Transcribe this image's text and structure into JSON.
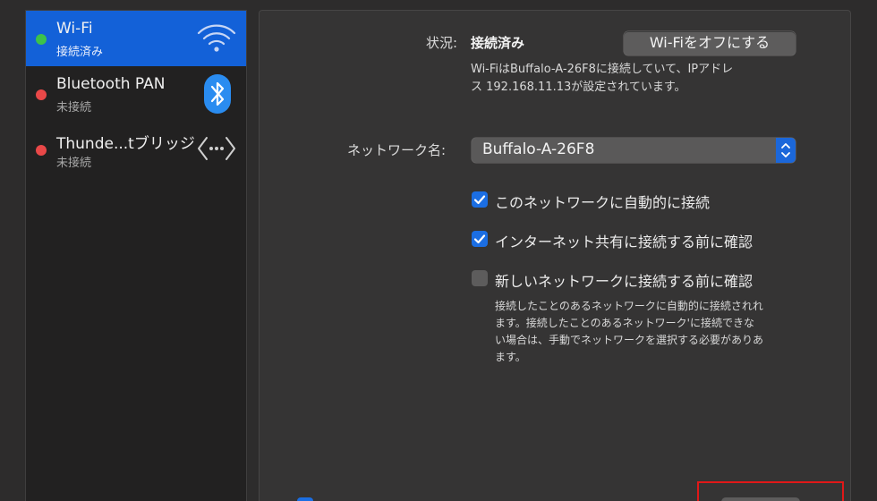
{
  "sidebar": {
    "services": [
      {
        "name": "Wi-Fi",
        "status": "接続済み",
        "dot_color": "#3cc24a",
        "icon": "wifi-icon",
        "selected": true
      },
      {
        "name": "Bluetooth PAN",
        "status": "未接続",
        "dot_color": "#e94848",
        "icon": "bluetooth-icon",
        "selected": false
      },
      {
        "name": "Thunde...tブリッジ",
        "status": "未接続",
        "dot_color": "#e94848",
        "icon": "thunderbolt-bridge-icon",
        "selected": false
      }
    ]
  },
  "detail": {
    "status_label": "状況:",
    "status_value": "接続済み",
    "toggle_button": "Wi-Fiをオフにする",
    "status_desc_line1": "Wi-FiはBuffalo-A-26F8に接続していて、IPアドレ",
    "status_desc_line2": "ス 192.168.11.13が設定されています。",
    "network_label": "ネットワーク名:",
    "network_value": "Buffalo-A-26F8",
    "options": [
      {
        "label": "このネットワークに自動的に接続",
        "checked": true
      },
      {
        "label": "インターネット共有に接続する前に確認",
        "checked": true
      },
      {
        "label": "新しいネットワークに接続する前に確認",
        "checked": false
      }
    ],
    "help_lines": [
      "接続したことのあるネットワークに自動的に接続されれ",
      "ます。接続したことのあるネットワーク'に接続できな",
      "い場合は、手動でネットワークを選択する必要がありあ",
      "ます。"
    ]
  },
  "colors": {
    "accent": "#1b6ee3",
    "selection": "#1361d8",
    "connected": "#3cc24a",
    "disconnected": "#e94848",
    "annotation": "#e01818"
  }
}
